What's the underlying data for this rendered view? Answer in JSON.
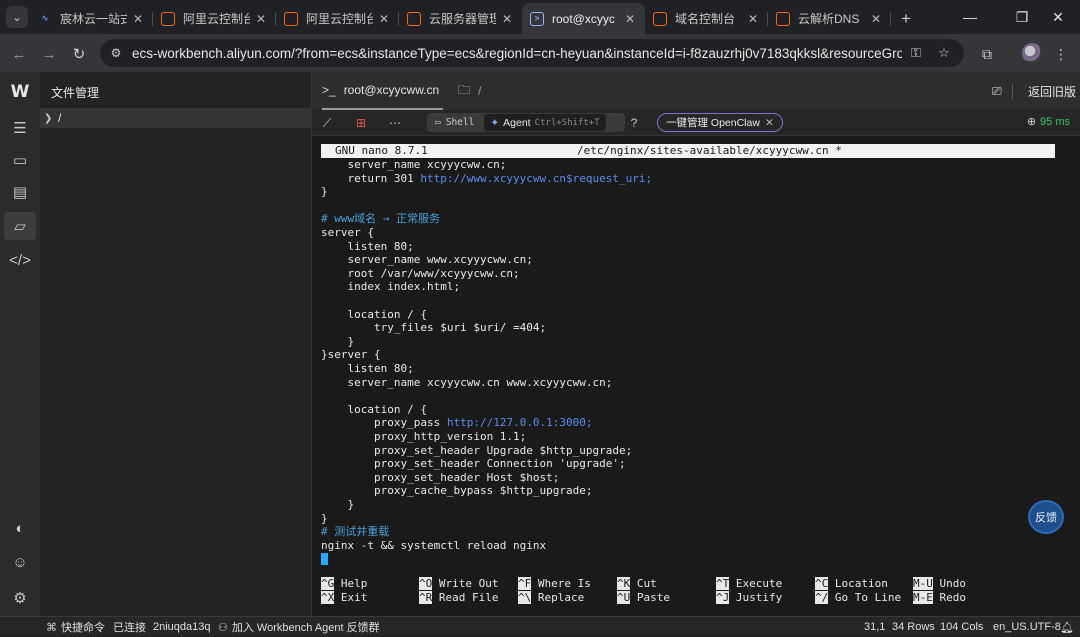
{
  "browser": {
    "tabs": [
      {
        "label": "宸林云一站式",
        "favicon": "blue-swoosh"
      },
      {
        "label": "阿里云控制台",
        "favicon": "aliyun-orange"
      },
      {
        "label": "阿里云控制台",
        "favicon": "aliyun-orange"
      },
      {
        "label": "云服务器管理",
        "favicon": "aliyun-orange"
      },
      {
        "label": "root@xcyyc",
        "favicon": "terminal",
        "active": true
      },
      {
        "label": "域名控制台",
        "favicon": "aliyun-orange"
      },
      {
        "label": "云解析DNS",
        "favicon": "aliyun-orange"
      }
    ],
    "new_tab": "+",
    "window_controls": {
      "minimize": "—",
      "maximize": "❐",
      "close": "✕"
    },
    "url": "ecs-workbench.aliyun.com/?from=ecs&instanceType=ecs&regionId=cn-heyuan&instanceId=i-f8zauzrhj0v7183qkksl&resourceGroupI..."
  },
  "sidebar": {
    "logo": "W",
    "items": [
      {
        "icon": "menu-icon"
      },
      {
        "icon": "terminal-icon"
      },
      {
        "icon": "instances-icon"
      },
      {
        "icon": "folder-icon",
        "active": true
      },
      {
        "icon": "code-icon"
      }
    ],
    "bottom_items": [
      {
        "icon": "theme-icon"
      },
      {
        "icon": "user-icon"
      },
      {
        "icon": "settings-icon"
      }
    ]
  },
  "file_panel": {
    "title": "文件管理",
    "root": "/"
  },
  "terminal_header": {
    "tab_session": "root@xcyycww.cn",
    "tab_files": "/",
    "back_label": "返回旧版"
  },
  "terminal_toolbar": {
    "mode_shell": "Shell",
    "mode_agent": "Agent",
    "agent_shortcut": "Ctrl+Shift+T",
    "openclaw_label": "一键管理 OpenClaw",
    "latency": "95 ms"
  },
  "nano": {
    "version": "GNU nano 8.7.1",
    "filename": "/etc/nginx/sites-available/xcyyycww.cn *",
    "lines": [
      [
        {
          "t": "    server_name xcyyycww.cn;"
        }
      ],
      [
        {
          "t": "    return 301 "
        },
        {
          "t": "http://www.xcyyycww.cn$request_uri;",
          "c": "url"
        }
      ],
      [
        {
          "t": "}"
        }
      ],
      [
        {
          "t": ""
        }
      ],
      [
        {
          "t": "# www域名 → 正常服务",
          "c": "comment"
        }
      ],
      [
        {
          "t": "server {"
        }
      ],
      [
        {
          "t": "    listen 80;"
        }
      ],
      [
        {
          "t": "    server_name www.xcyyycww.cn;"
        }
      ],
      [
        {
          "t": "    root /var/www/xcyyycww.cn;"
        }
      ],
      [
        {
          "t": "    index index.html;"
        }
      ],
      [
        {
          "t": ""
        }
      ],
      [
        {
          "t": "    location / {"
        }
      ],
      [
        {
          "t": "        try_files $uri $uri/ =404;"
        }
      ],
      [
        {
          "t": "    }"
        }
      ],
      [
        {
          "t": "}server {"
        }
      ],
      [
        {
          "t": "    listen 80;"
        }
      ],
      [
        {
          "t": "    server_name xcyyycww.cn www.xcyyycww.cn;"
        }
      ],
      [
        {
          "t": ""
        }
      ],
      [
        {
          "t": "    location / {"
        }
      ],
      [
        {
          "t": "        proxy_pass "
        },
        {
          "t": "http://127.0.0.1:3000;",
          "c": "url"
        }
      ],
      [
        {
          "t": "        proxy_http_version 1.1;"
        }
      ],
      [
        {
          "t": "        proxy_set_header Upgrade $http_upgrade;"
        }
      ],
      [
        {
          "t": "        proxy_set_header Connection 'upgrade';"
        }
      ],
      [
        {
          "t": "        proxy_set_header Host $host;"
        }
      ],
      [
        {
          "t": "        proxy_cache_bypass $http_upgrade;"
        }
      ],
      [
        {
          "t": "    }"
        }
      ],
      [
        {
          "t": "}"
        }
      ],
      [
        {
          "t": "# 测试并重载",
          "c": "comment"
        }
      ],
      [
        {
          "t": "nginx -t && systemctl reload nginx"
        }
      ],
      [
        {
          "t": "",
          "cursor": true
        }
      ]
    ],
    "shortcuts_row1": [
      {
        "key": "^G",
        "label": "Help"
      },
      {
        "key": "^O",
        "label": "Write Out"
      },
      {
        "key": "^F",
        "label": "Where Is"
      },
      {
        "key": "^K",
        "label": "Cut"
      },
      {
        "key": "^T",
        "label": "Execute"
      },
      {
        "key": "^C",
        "label": "Location"
      },
      {
        "key": "M-U",
        "label": "Undo"
      }
    ],
    "shortcuts_row2": [
      {
        "key": "^X",
        "label": "Exit"
      },
      {
        "key": "^R",
        "label": "Read File"
      },
      {
        "key": "^\\",
        "label": "Replace"
      },
      {
        "key": "^U",
        "label": "Paste"
      },
      {
        "key": "^J",
        "label": "Justify"
      },
      {
        "key": "^/",
        "label": "Go To Line"
      },
      {
        "key": "M-E",
        "label": "Redo"
      }
    ]
  },
  "feedback_button": "反馈",
  "status_bar": {
    "quick_cmd": "快捷命令",
    "connected": "已连接",
    "session_id": "2niuqda13q",
    "join_group": "加入 Workbench Agent 反馈群",
    "cursor_pos": "31,1",
    "rows": "34 Rows",
    "cols": "104 Cols",
    "encoding": "en_US.UTF-8"
  },
  "colors": {
    "accent_orange": "#ff6a00",
    "url_blue": "#5a8dee",
    "comment_blue": "#4aa0d8",
    "latency_green": "#3fbf6f",
    "cursor_blue": "#2aa8ff"
  }
}
